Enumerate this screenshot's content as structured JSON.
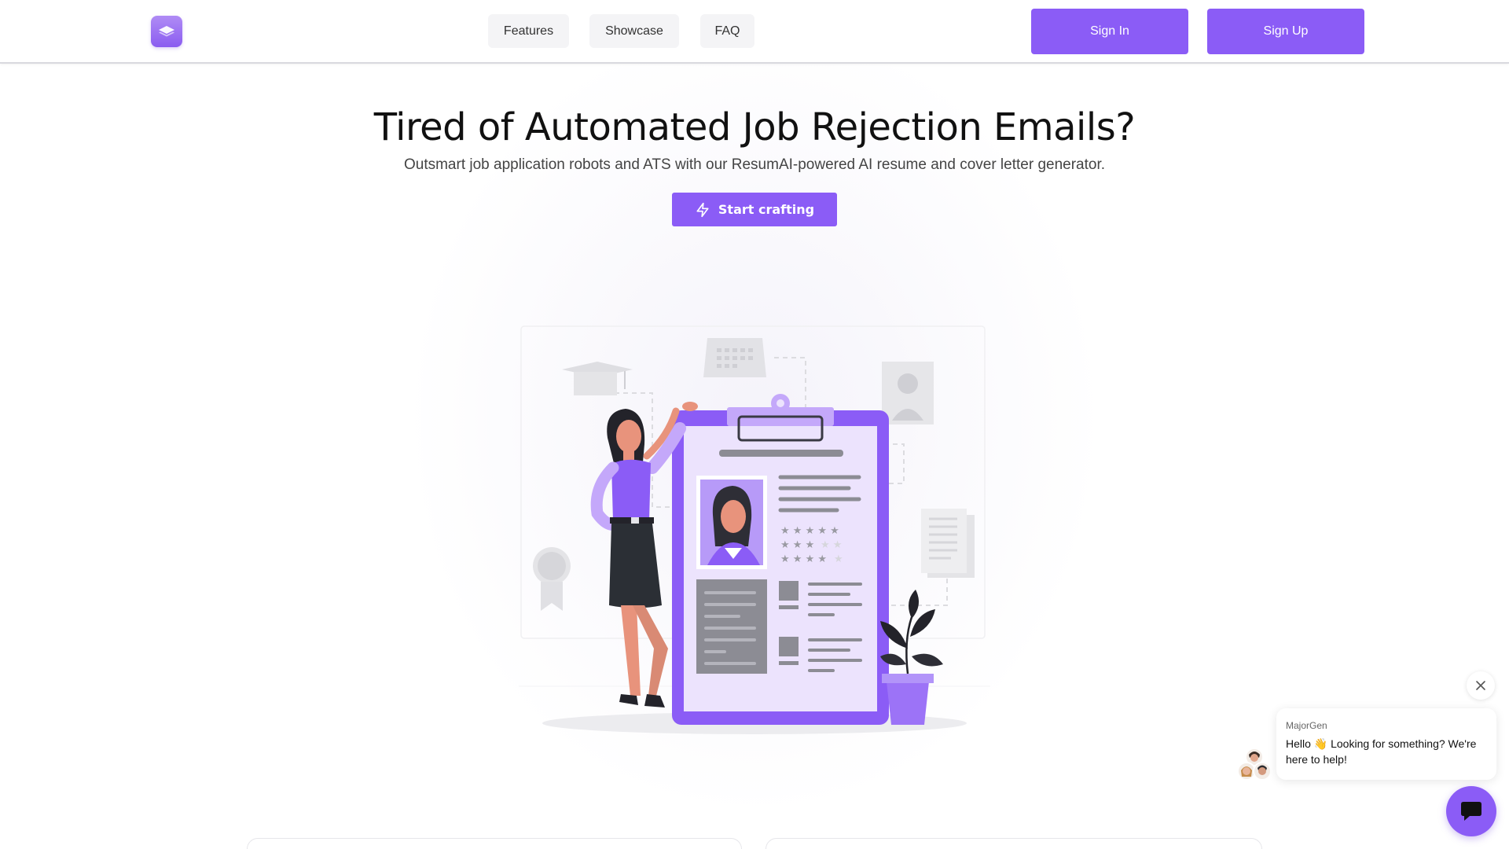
{
  "header": {
    "logo_icon": "layers-logo-icon",
    "nav": [
      {
        "label": "Features"
      },
      {
        "label": "Showcase"
      },
      {
        "label": "FAQ"
      }
    ],
    "sign_in_label": "Sign In",
    "sign_up_label": "Sign Up"
  },
  "hero": {
    "title": "Tired of Automated Job Rejection Emails?",
    "subtitle": "Outsmart job application robots and ATS with our ResumAI-powered AI resume and cover letter generator.",
    "cta_label": "Start crafting",
    "cta_icon": "lightning-icon",
    "illustration": "woman-with-resume-clipboard-illustration"
  },
  "chat": {
    "agent_name": "MajorGen",
    "message": "Hello 👋 Looking for something? We're here to help!",
    "close_icon": "close-icon",
    "launcher_icon": "chat-icon"
  },
  "colors": {
    "accent": "#8b5cf6",
    "accent_light": "#e9defd",
    "text_dark": "#111111",
    "text_muted": "#444444"
  }
}
